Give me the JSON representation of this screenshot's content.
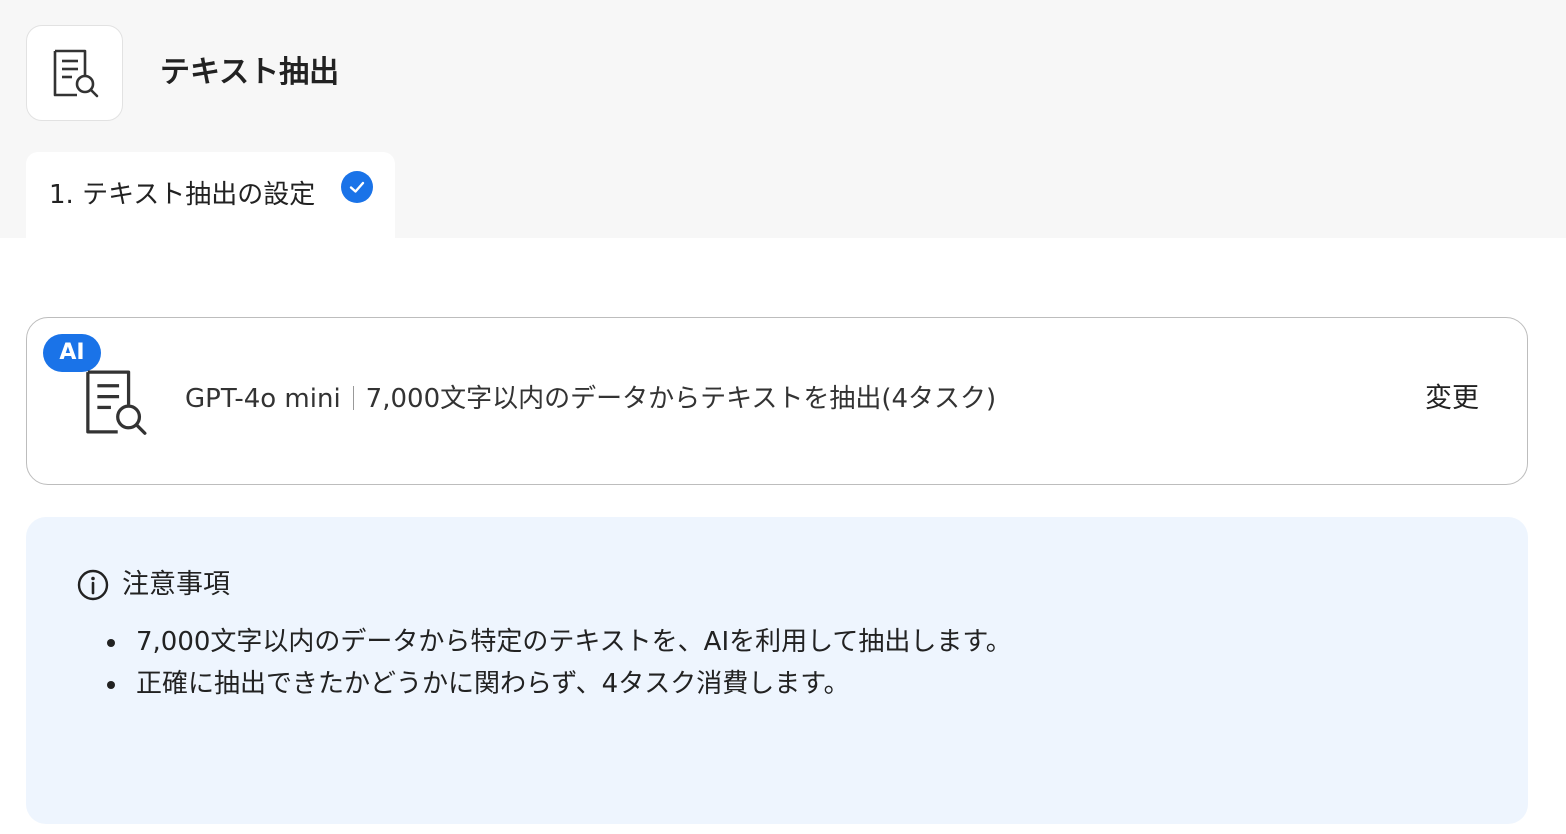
{
  "header": {
    "app_icon": "document-search-icon",
    "title": "テキスト抽出"
  },
  "steps": [
    {
      "label": "1. テキスト抽出の設定",
      "status": "completed",
      "status_icon": "check-circle-icon"
    }
  ],
  "action_card": {
    "badge": "AI",
    "icon": "document-search-icon",
    "model": "GPT-4o mini",
    "description": "7,000文字以内のデータからテキストを抽出(4タスク)",
    "change_label": "変更"
  },
  "notice": {
    "icon": "info-icon",
    "title": "注意事項",
    "items": [
      "7,000文字以内のデータから特定のテキストを、AIを利用して抽出します。",
      "正確に抽出できたかどうかに関わらず、4タスク消費します。"
    ]
  },
  "colors": {
    "accent": "#1a73e8",
    "top_background": "#f7f7f7",
    "notice_background": "#eef5fe",
    "border": "#bdbdbd"
  }
}
